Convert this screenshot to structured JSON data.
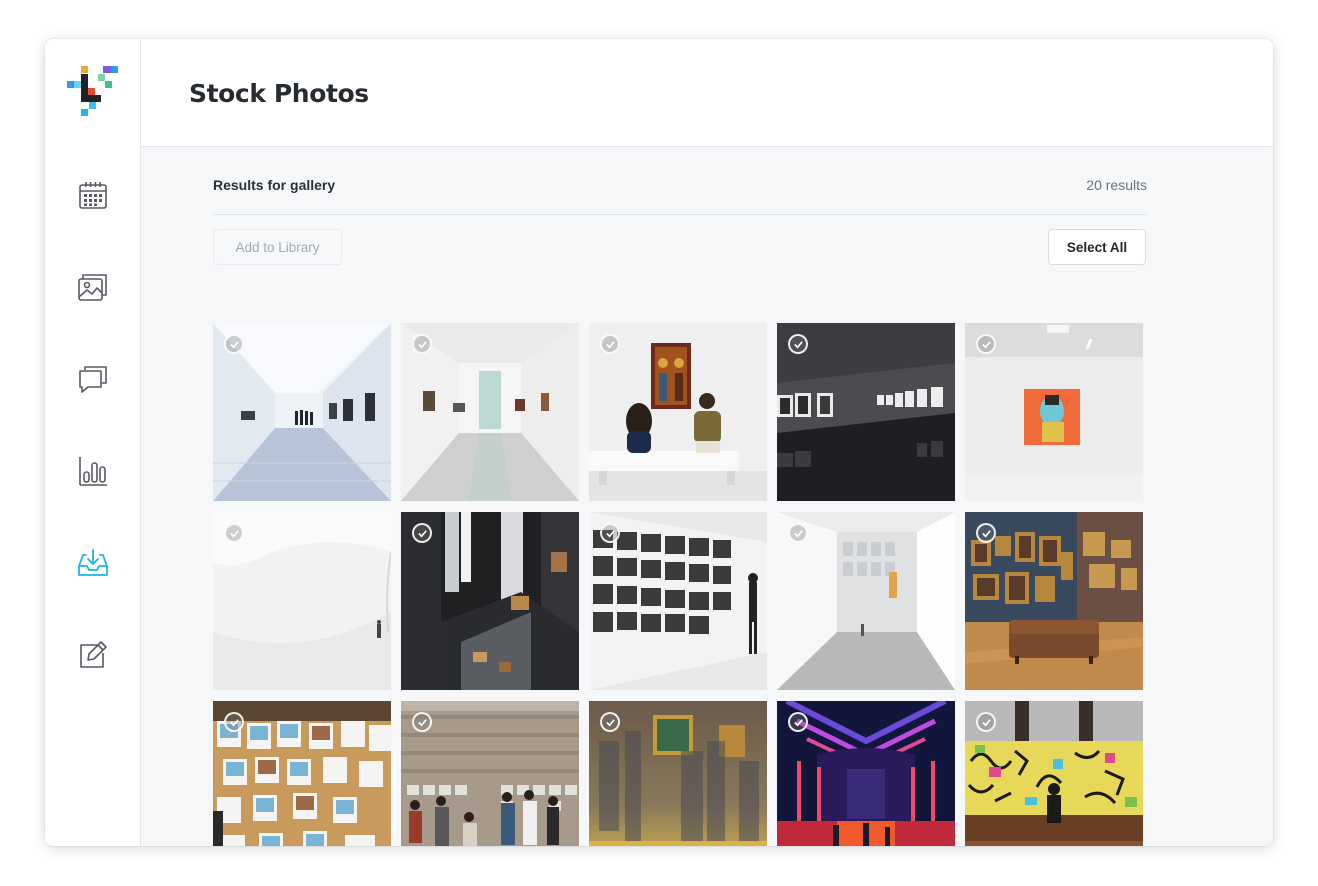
{
  "header": {
    "title": "Stock Photos"
  },
  "results": {
    "label": "Results for gallery",
    "count": "20 results"
  },
  "toolbar": {
    "add_label": "Add to Library",
    "select_all_label": "Select All"
  },
  "sidebar": {
    "items": [
      {
        "name": "calendar-icon",
        "active": false
      },
      {
        "name": "images-icon",
        "active": false
      },
      {
        "name": "comments-icon",
        "active": false
      },
      {
        "name": "bar-chart-icon",
        "active": false
      },
      {
        "name": "inbox-download-icon",
        "active": true
      },
      {
        "name": "edit-icon",
        "active": false
      }
    ]
  },
  "colors": {
    "accent": "#1fb3e8",
    "icon": "#555a62",
    "background": "#f6f7f9"
  },
  "photos": [
    {
      "scene": "white-gallery-corridor-perspective",
      "selected": false
    },
    {
      "scene": "white-gallery-glossy-floor",
      "selected": false
    },
    {
      "scene": "two-visitors-on-bench-icon-painting",
      "selected": false
    },
    {
      "scene": "dark-gray-gallery-framed-photos",
      "selected": false
    },
    {
      "scene": "orange-portrait-on-white-wall",
      "selected": false
    },
    {
      "scene": "white-curved-room-person",
      "selected": false
    },
    {
      "scene": "dark-multi-level-exhibition",
      "selected": false
    },
    {
      "scene": "black-and-white-photo-wall",
      "selected": false
    },
    {
      "scene": "white-corridor-broad-museum",
      "selected": false
    },
    {
      "scene": "salon-style-painting-room-sofa",
      "selected": false
    },
    {
      "scene": "polaroids-pinned-on-corkboard",
      "selected": false
    },
    {
      "scene": "crowd-viewing-photo-wall",
      "selected": false
    },
    {
      "scene": "blurred-visitors-golden-painting",
      "selected": false
    },
    {
      "scene": "neon-lit-arched-hall",
      "selected": false
    },
    {
      "scene": "graffiti-mural-visitor",
      "selected": false
    }
  ]
}
